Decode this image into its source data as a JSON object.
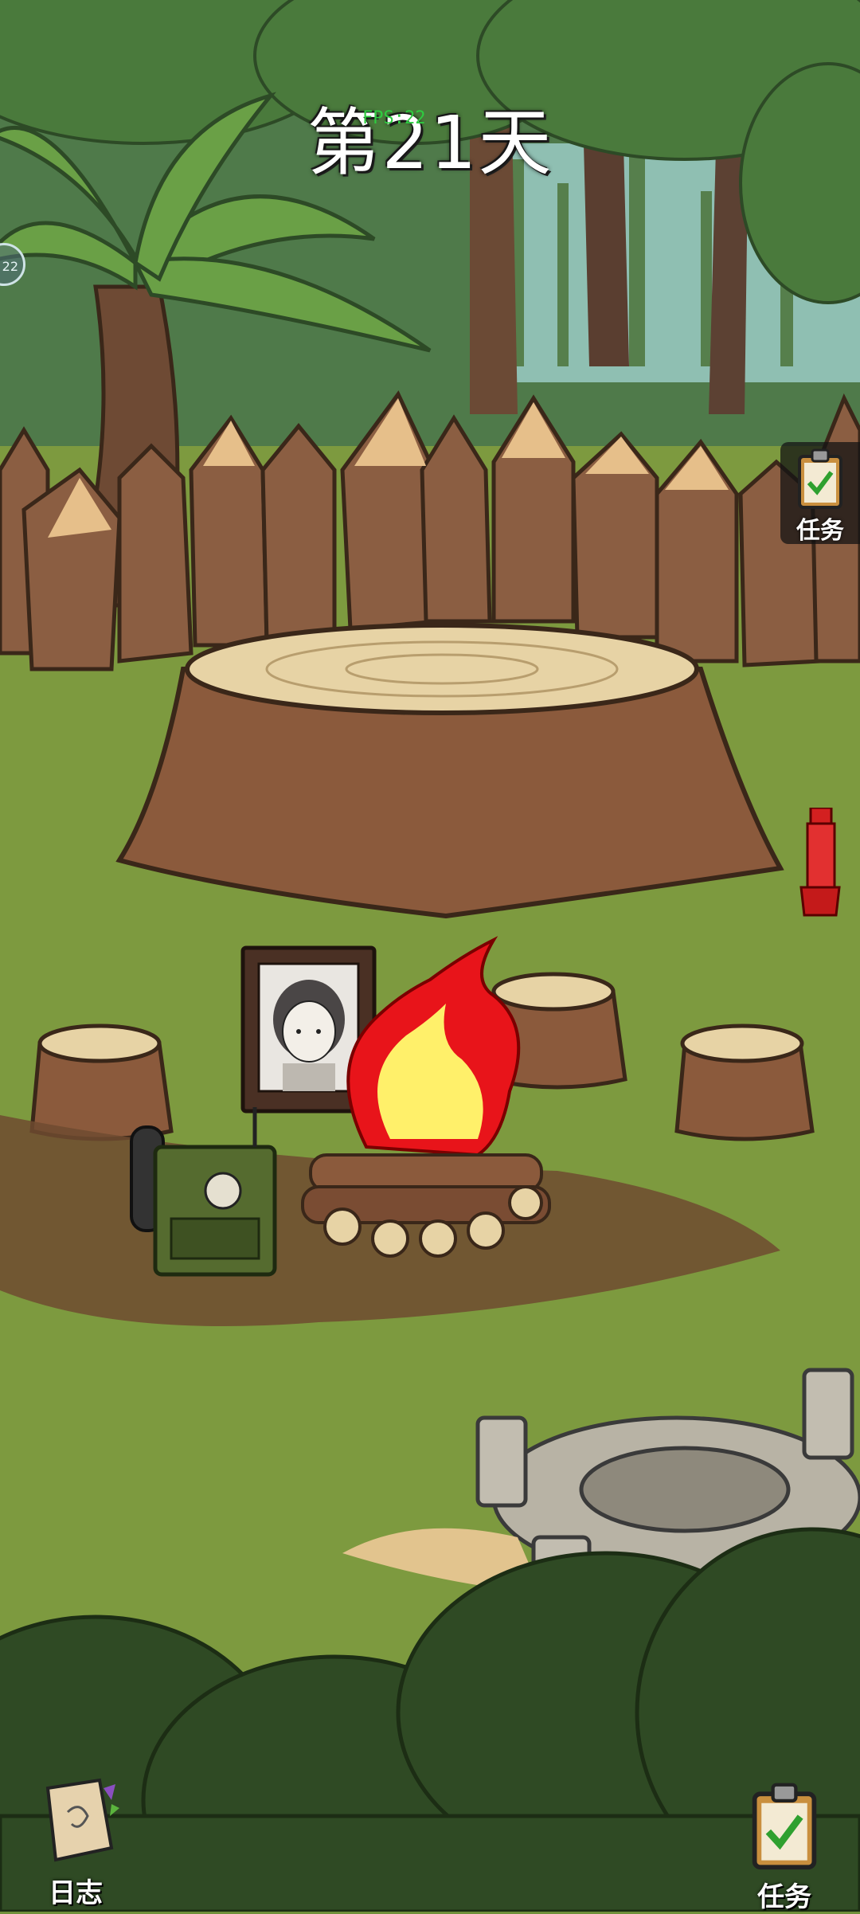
{
  "hud": {
    "day_title": "第21天",
    "fps_label": "FPS:22",
    "side_bubble_text": "22"
  },
  "buttons": {
    "task_top_label": "任务",
    "diary_label": "日志",
    "task_bottom_label": "任务"
  },
  "scene": {
    "items": [
      "portrait-frame",
      "campfire",
      "radio-transmitter",
      "flashlight",
      "stone-well"
    ]
  },
  "colors": {
    "grass": "#7d9a3f",
    "forest": "#3f6a37",
    "wood": "#8b5a3c",
    "fire_red": "#e8141a",
    "fire_yellow": "#fff06a"
  }
}
